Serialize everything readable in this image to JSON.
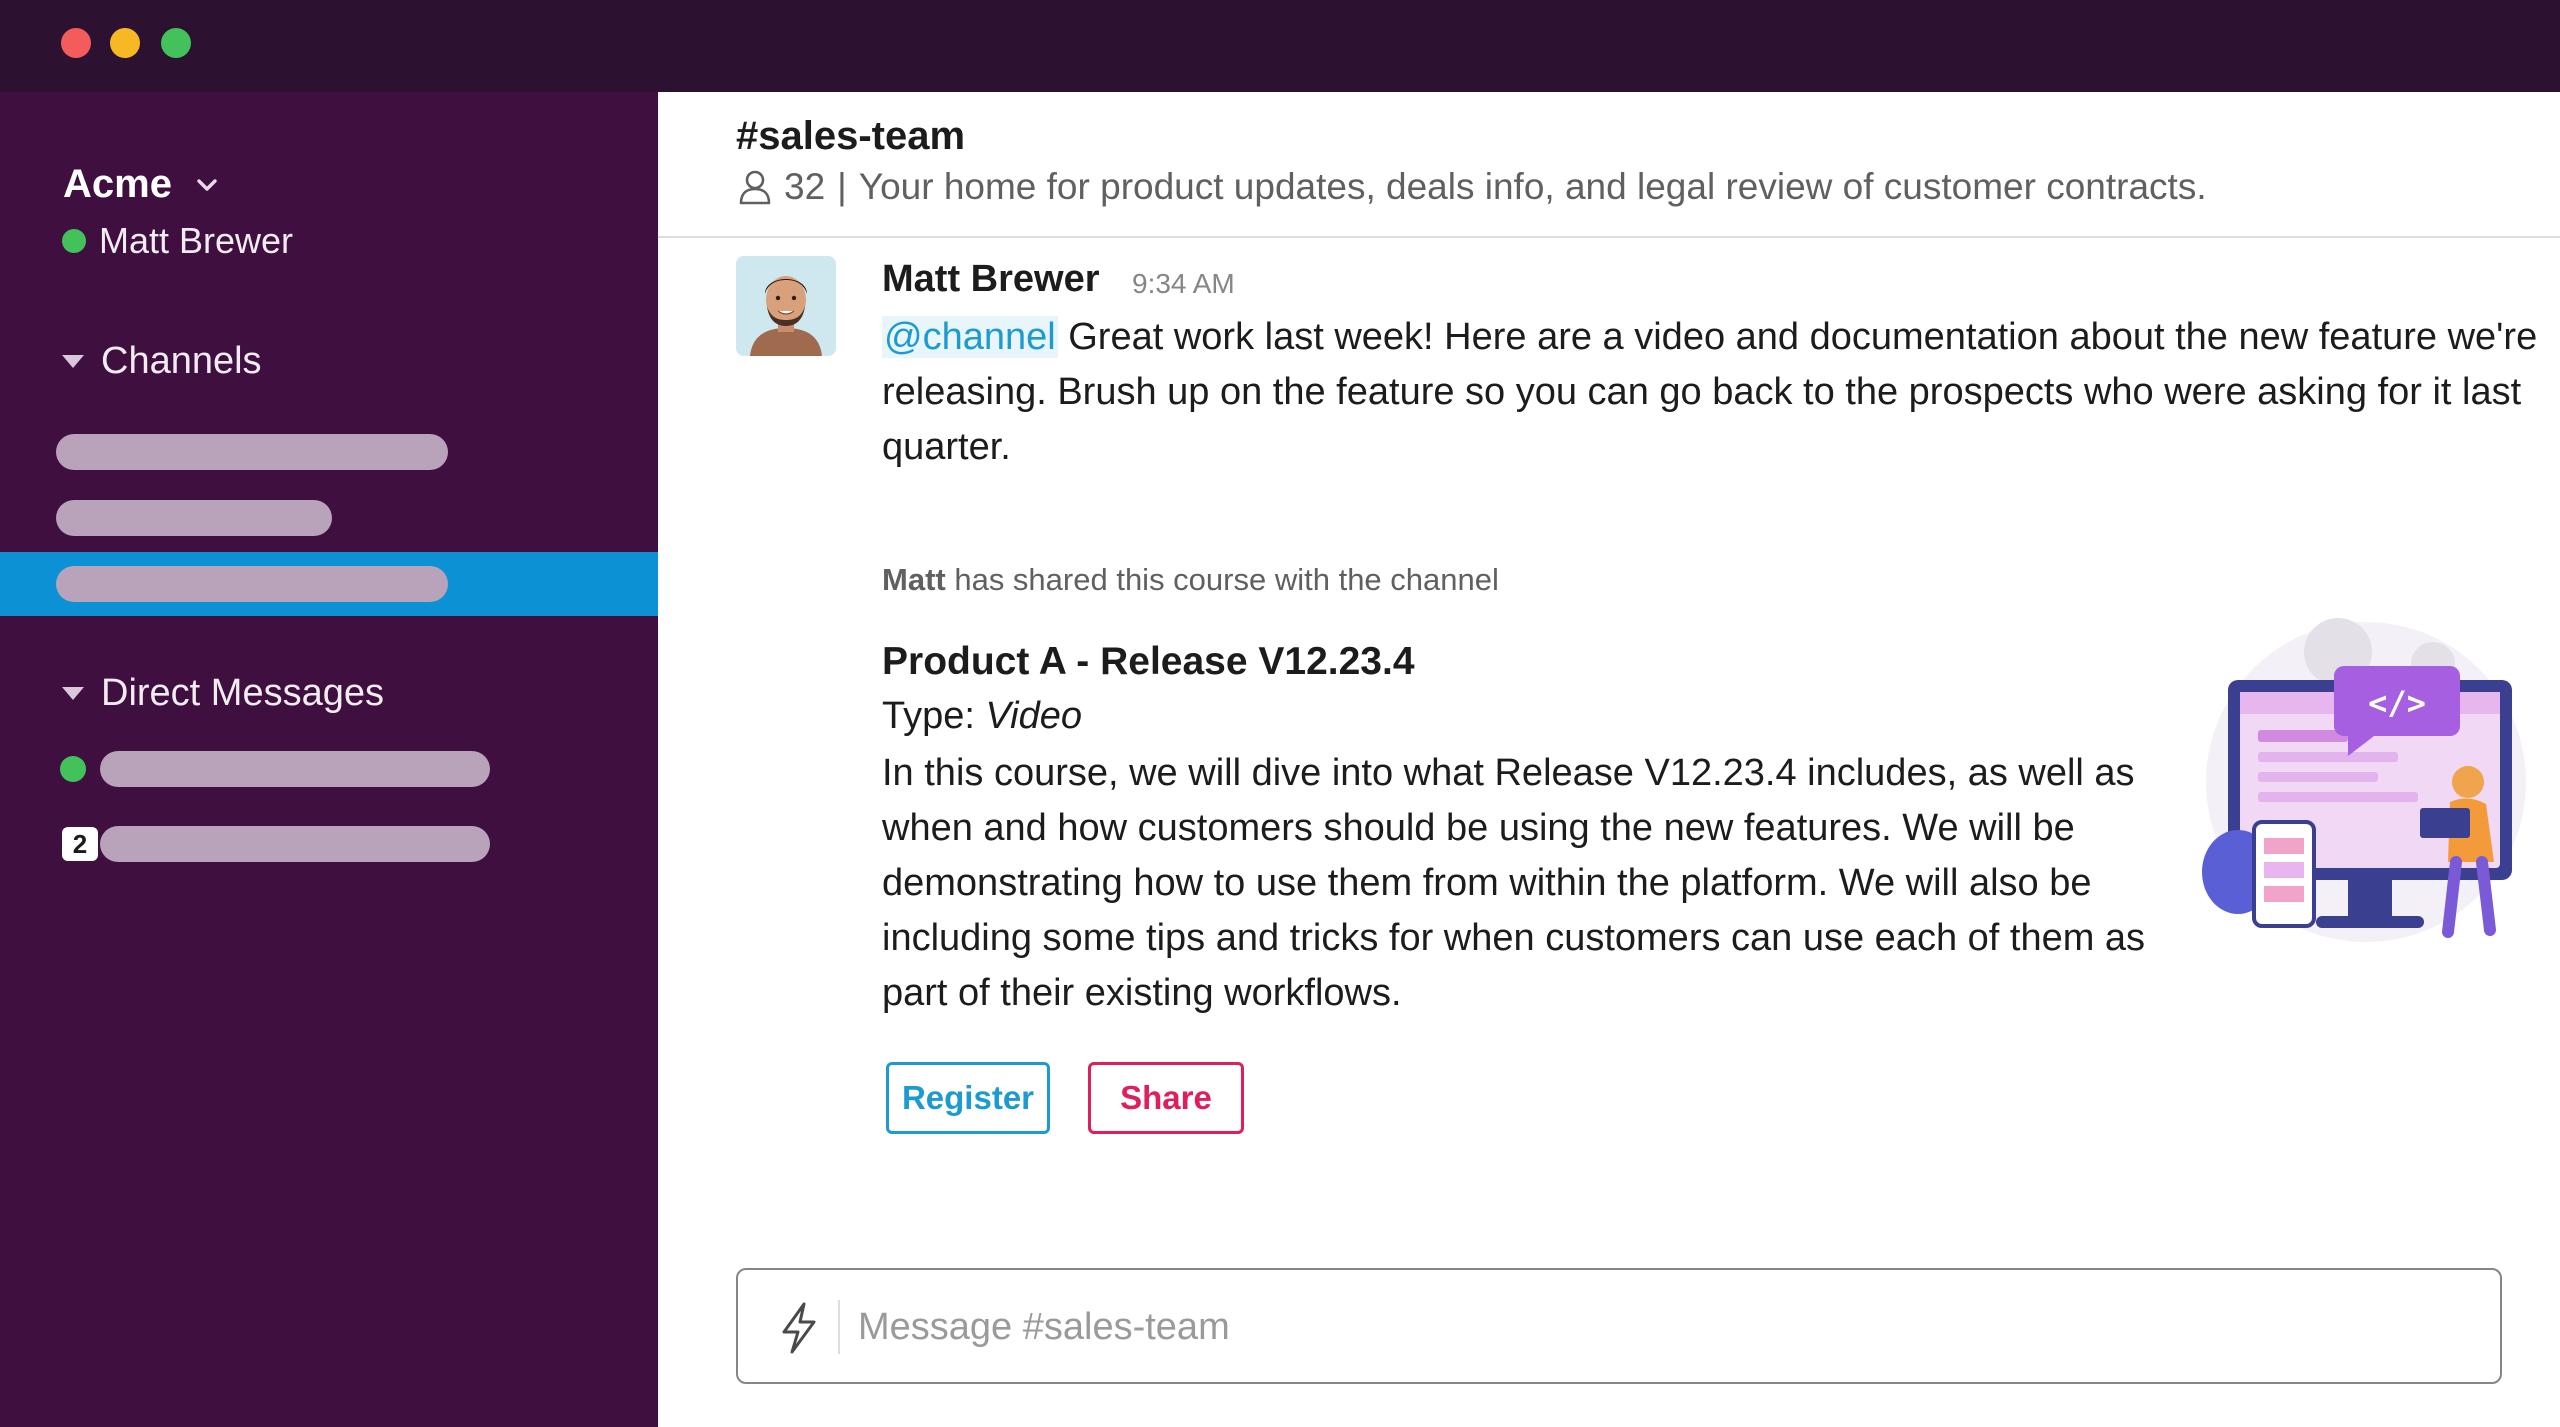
{
  "workspace": {
    "name": "Acme",
    "user_name": "Matt Brewer"
  },
  "sidebar": {
    "channels_label": "Channels",
    "dms_label": "Direct Messages",
    "dm_unread_count": "2"
  },
  "channel": {
    "title": "#sales-team",
    "member_count": "32",
    "separator": "|",
    "topic": "Your home for product updates, deals info, and legal review of customer contracts."
  },
  "message": {
    "author": "Matt Brewer",
    "time": "9:34 AM",
    "mention": "@channel",
    "text": " Great work last week! Here are a video and documentation about the new feature we're releasing. Brush up on the feature so you can go back to the prospects who were asking for it last quarter."
  },
  "share": {
    "sharer": "Matt",
    "note": " has shared this course with the channel"
  },
  "course": {
    "title": "Product A - Release V12.23.4",
    "type_label": "Type: ",
    "type_value": "Video",
    "description": "In this course, we will dive into what Release V12.23.4 includes, as well as when and how customers should be using the new features. We will be demonstrating how to use them from within the platform. We will also be including some tips and tricks for when customers can use each of them as part of their existing workflows.",
    "register_label": "Register",
    "share_label": "Share",
    "illustration_code": "</>"
  },
  "composer": {
    "placeholder": "Message #sales-team"
  },
  "colors": {
    "titlebar": "#2c1230",
    "sidebar": "#3f0f3f",
    "active_channel": "#0b91d4",
    "mention": "#1d9bd1",
    "register": "#1d9bd1",
    "share": "#e01e5a",
    "presence": "#43c25b"
  }
}
